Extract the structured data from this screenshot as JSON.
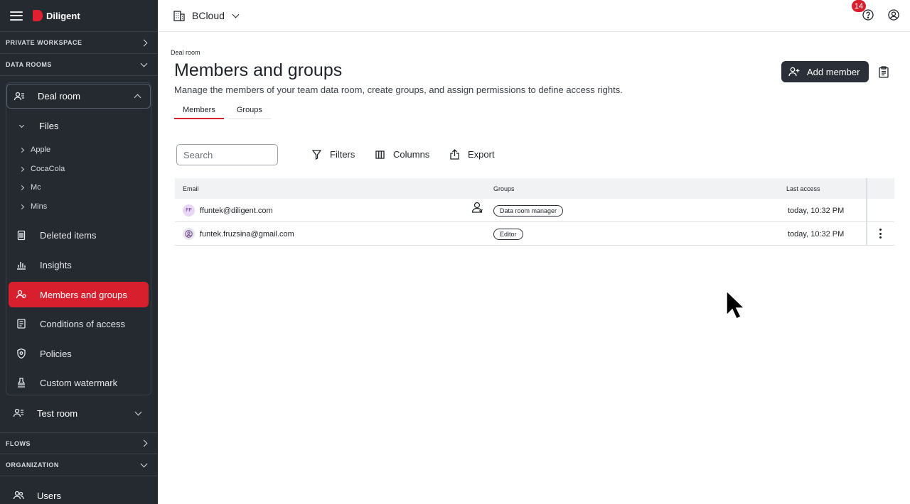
{
  "app": {
    "logo_text": "Diligent",
    "org_name": "BCloud",
    "notification_count": "14"
  },
  "sidebar": {
    "private_workspace": "PRIVATE WORKSPACE",
    "data_rooms": "DATA ROOMS",
    "deal_room": "Deal room",
    "files": "Files",
    "folders": [
      "Apple",
      "CocaCola",
      "Mc",
      "Mins"
    ],
    "items": [
      {
        "label": "Deleted items",
        "icon": "trash-icon"
      },
      {
        "label": "Insights",
        "icon": "bar-chart-icon"
      },
      {
        "label": "Members and groups",
        "icon": "members-icon"
      },
      {
        "label": "Conditions of access",
        "icon": "document-icon"
      },
      {
        "label": "Policies",
        "icon": "shield-icon"
      },
      {
        "label": "Custom watermark",
        "icon": "stamp-icon"
      }
    ],
    "test_room": "Test room",
    "flows": "FLOWS",
    "organization": "ORGANIZATION",
    "users": "Users"
  },
  "main": {
    "breadcrumb": "Deal room",
    "title": "Members and groups",
    "subtitle": "Manage the members of your team data room, create groups, and assign permissions to define access rights.",
    "add_member": "Add member",
    "tabs": [
      "Members",
      "Groups"
    ],
    "search_placeholder": "Search",
    "filters": "Filters",
    "columns": "Columns",
    "export": "Export"
  },
  "table": {
    "headers": {
      "email": "Email",
      "groups": "Groups",
      "last_access": "Last access"
    },
    "rows": [
      {
        "initials": "FF",
        "email": "ffuntek@diligent.com",
        "group": "Data room manager",
        "last_access": "today, 10:32 PM"
      },
      {
        "initials": "",
        "email": "funtek.fruzsina@gmail.com",
        "group": "Editor",
        "last_access": "today, 10:32 PM"
      }
    ]
  },
  "colors": {
    "sidebar_bg": "#252a31",
    "accent": "#d81f2e",
    "button_dark": "#2b3038"
  }
}
